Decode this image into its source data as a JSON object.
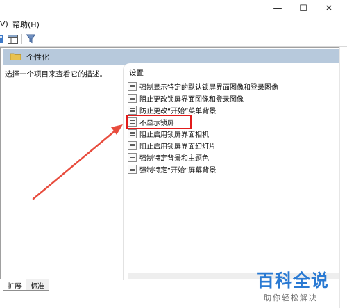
{
  "window": {
    "minimize_glyph": "—",
    "maximize_glyph": "☐",
    "close_glyph": "✕"
  },
  "menu": {
    "clipped_label": "V)",
    "help_label": "帮助(H)"
  },
  "toolbar": {
    "icons": [
      "toolbar-icon-a",
      "show-hide-pane-icon",
      "filter-icon"
    ]
  },
  "panel": {
    "header_title": "个性化",
    "left_description": "选择一个项目来查看它的描述。",
    "column_header": "设置",
    "settings": [
      "强制显示特定的默认锁屏界面图像和登录图像",
      "阻止更改锁屏界面图像和登录图像",
      "防止更改“开始”菜单背景",
      "不显示锁屏",
      "阻止启用锁屏界面相机",
      "阻止启用锁屏界面幻灯片",
      "强制特定背景和主题色",
      "强制特定“开始”屏幕背景"
    ],
    "highlighted_setting": "不显示锁屏"
  },
  "tabs": {
    "extended": "扩展",
    "standard": "标准"
  },
  "colors": {
    "header_bg": "#b7c9dc",
    "highlight": "#e11b1b",
    "arrow": "#e84c3d",
    "watermark": "#2a7ad3"
  },
  "watermark": {
    "title": "百科全说",
    "subtitle": "助你轻松解决"
  }
}
